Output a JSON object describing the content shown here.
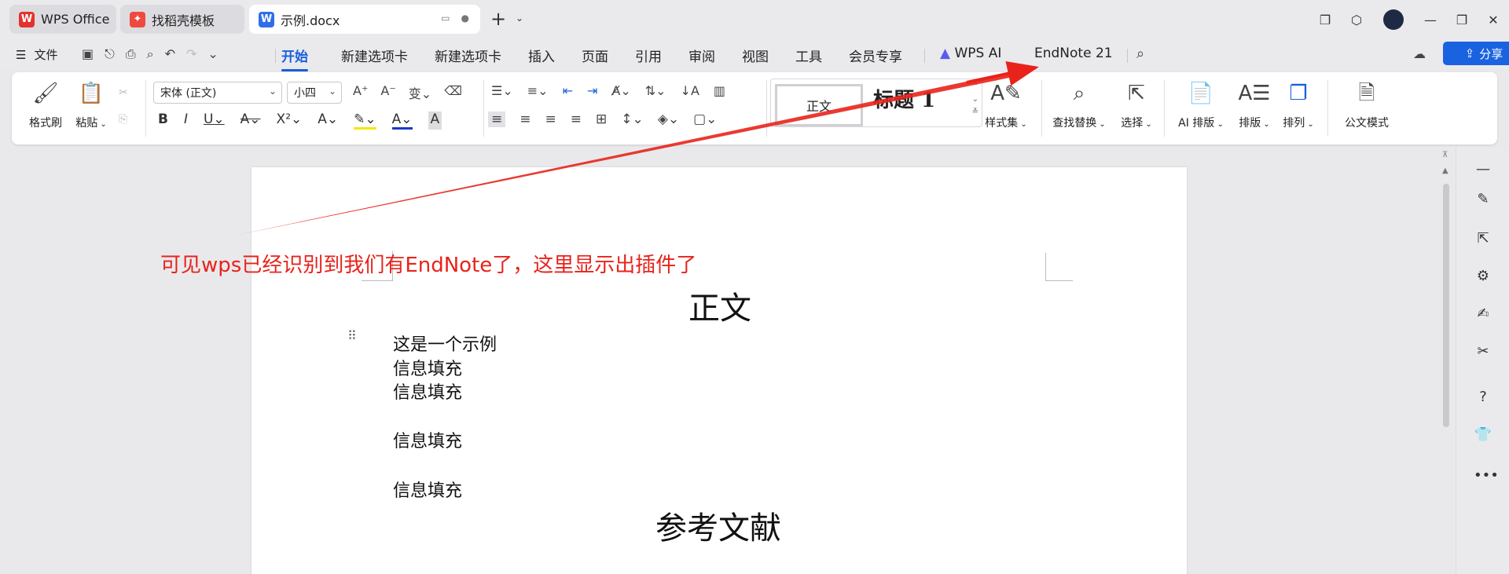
{
  "tabs": [
    {
      "label": "WPS Office",
      "icon": "wps-logo-icon"
    },
    {
      "label": "找稻壳模板",
      "icon": "docer-icon"
    },
    {
      "label": "示例.docx",
      "icon": "word-doc-icon"
    }
  ],
  "menu": {
    "file_label": "文件",
    "tabs": [
      "开始",
      "新建选项卡",
      "新建选项卡",
      "插入",
      "页面",
      "引用",
      "审阅",
      "视图",
      "工具",
      "会员专享"
    ],
    "wps_ai": "WPS AI",
    "endnote": "EndNote 21",
    "share": "分享"
  },
  "ribbon": {
    "format_painter": "格式刷",
    "paste": "粘贴",
    "font_name": "宋体 (正文)",
    "font_size": "小四",
    "style_normal": "正文",
    "style_h1": "标题 1",
    "style_set": "样式集",
    "find_replace": "查找替换",
    "select": "选择",
    "ai_layout": "AI 排版",
    "layout": "排版",
    "arrange": "排列",
    "official_mode": "公文模式"
  },
  "document": {
    "title": "正文",
    "lines": [
      "这是一个示例",
      "信息填充",
      "信息填充",
      "信息填充",
      "信息填充"
    ],
    "references_heading": "参考文献"
  },
  "annotation": {
    "text": "可见wps已经识别到我们有EndNote了，这里显示出插件了",
    "color": "#e8231b"
  },
  "colors": {
    "accent": "#1a5fdb",
    "share_button": "#1a63e0"
  }
}
